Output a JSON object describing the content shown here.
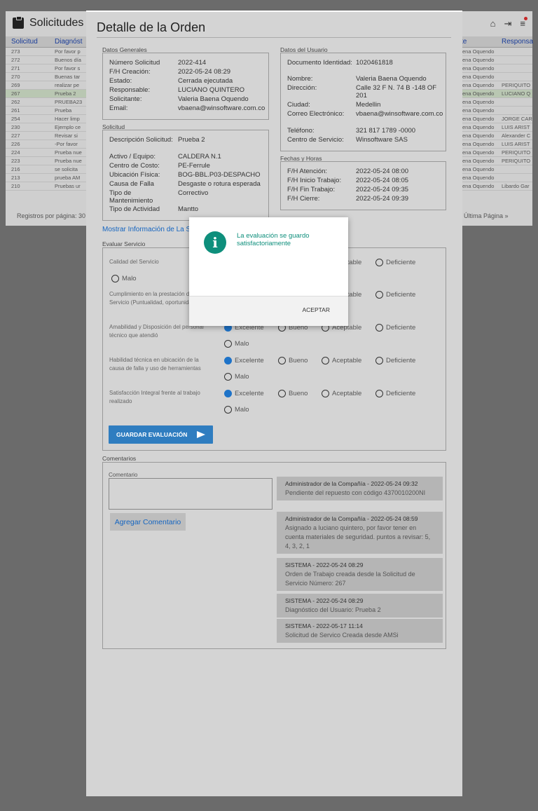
{
  "background": {
    "title": "Solicitudes",
    "columns": [
      "Solicitud",
      "Diagnóst",
      "te",
      "Responsa"
    ],
    "rows": [
      {
        "id": "273",
        "diag": "Por favor p",
        "resp": "ena Oquendo",
        "owner": ""
      },
      {
        "id": "272",
        "diag": "Buenos día",
        "resp": "ena Oquendo",
        "owner": ""
      },
      {
        "id": "271",
        "diag": "Por favor s",
        "resp": "ena Oquendo",
        "owner": ""
      },
      {
        "id": "270",
        "diag": "Buenas tar",
        "resp": "ena Oquendo",
        "owner": ""
      },
      {
        "id": "269",
        "diag": "realizar pe",
        "resp": "ena Oquendo",
        "owner": "PERIQUITO"
      },
      {
        "id": "267",
        "diag": "Prueba 2",
        "resp": "ena Oquendo",
        "owner": "LUCIANO Q"
      },
      {
        "id": "262",
        "diag": "PRUEBA23",
        "resp": "ena Oquendo",
        "owner": ""
      },
      {
        "id": "261",
        "diag": "Prueba",
        "resp": "ena Oquendo",
        "owner": ""
      },
      {
        "id": "254",
        "diag": "Hacer limp",
        "resp": "ena Oquendo",
        "owner": "JORGE CAR"
      },
      {
        "id": "230",
        "diag": "Ejemplo ce",
        "resp": "ena Oquendo",
        "owner": "LUIS ARIST"
      },
      {
        "id": "227",
        "diag": "Revisar si",
        "resp": "ena Oquendo",
        "owner": "Alexander C"
      },
      {
        "id": "226",
        "diag": "-Por favor",
        "resp": "ena Oquendo",
        "owner": "LUIS ARIST"
      },
      {
        "id": "224",
        "diag": "Prueba nue",
        "resp": "ena Oquendo",
        "owner": "PERIQUITO"
      },
      {
        "id": "223",
        "diag": "Prueba nue",
        "resp": "ena Oquendo",
        "owner": "PERIQUITO"
      },
      {
        "id": "216",
        "diag": "se solicita",
        "resp": "ena Oquendo",
        "owner": ""
      },
      {
        "id": "213",
        "diag": "prueba AM",
        "resp": "ena Oquendo",
        "owner": ""
      },
      {
        "id": "210",
        "diag": "Pruebas ur",
        "resp": "ena Oquendo",
        "owner": "Libardo Gar"
      }
    ],
    "footer": {
      "rows_per_page": "Registros por página: 30",
      "last_page": "Última Página »"
    }
  },
  "panel": {
    "title": "Detalle de la Orden",
    "general": {
      "label": "Datos Generales",
      "fields": [
        {
          "k": "Número Solicitud",
          "v": "2022-414"
        },
        {
          "k": "F/H Creación:",
          "v": "2022-05-24 08:29"
        },
        {
          "k": "Estado:",
          "v": "Cerrada ejecutada"
        },
        {
          "k": "Responsable:",
          "v": "LUCIANO QUINTERO"
        },
        {
          "k": "Solicitante:",
          "v": "Valeria Baena Oquendo"
        },
        {
          "k": "Email:",
          "v": "vbaena@winsoftware.com.co"
        }
      ]
    },
    "user": {
      "label": "Datos del Usuario",
      "fields": [
        {
          "k": "Documento Identidad:",
          "v": "1020461818"
        },
        {
          "k": "Nombre:",
          "v": "Valeria Baena Oquendo"
        },
        {
          "k": "Dirección:",
          "v": "Calle 32 F N. 74 B -148 OF 201"
        },
        {
          "k": "Ciudad:",
          "v": "Medellin"
        },
        {
          "k": "Correo Electrónico:",
          "v": "vbaena@winsoftware.com.co"
        },
        {
          "k": "Teléfono:",
          "v": "321 817 1789 -0000"
        },
        {
          "k": "Centro de Servicio:",
          "v": "Winsoftware SAS"
        }
      ]
    },
    "request": {
      "label": "Solicitud",
      "fields": [
        {
          "k": "Descripción Solicitud:",
          "v": "Prueba 2"
        },
        {
          "k": "Activo / Equipo:",
          "v": "CALDERA N.1"
        },
        {
          "k": "Centro de Costo:",
          "v": "PE-Ferrule"
        },
        {
          "k": "Ubicación Física:",
          "v": "BOG-BBL.P03-DESPACHO"
        },
        {
          "k": "Causa de Falla",
          "v": "Desgaste o rotura esperada"
        },
        {
          "k": "Tipo de Mantenimiento",
          "v": "Correctivo"
        },
        {
          "k": "Tipo de Actividad",
          "v": "Mantto"
        }
      ]
    },
    "dates": {
      "label": "Fechas y Horas",
      "fields": [
        {
          "k": "F/H Atención:",
          "v": "2022-05-24 08:00"
        },
        {
          "k": "F/H Inicio Trabajo:",
          "v": "2022-05-24 08:05"
        },
        {
          "k": "F/H Fin Trabajo:",
          "v": "2022-05-24 09:35"
        },
        {
          "k": "F/H Cierre:",
          "v": "2022-05-24 09:39"
        }
      ]
    },
    "show_more_link": "Mostrar Información de La S",
    "evaluation": {
      "label": "Evaluar Servicio",
      "options": [
        "Excelente",
        "Bueno",
        "Aceptable",
        "Deficiente",
        "Malo"
      ],
      "questions": [
        {
          "text": "Calidad del Servicio",
          "selected": null
        },
        {
          "text": "Cumplimiento en la prestación del Servicio (Puntualidad, oportunidad)",
          "selected": null
        },
        {
          "text": "Amabilidad y Disposición del personal técnico que atendió",
          "selected": "Excelente"
        },
        {
          "text": "Habilidad técnica en ubicación de la causa de falla y uso de herramientas",
          "selected": "Excelente"
        },
        {
          "text": "Satisfacción Integral frente al trabajo realizado",
          "selected": "Excelente"
        }
      ],
      "save_label": "GUARDAR EVALUACIÓN"
    },
    "comments": {
      "label": "Comentarios",
      "input_label": "Comentario",
      "add_label": "Agregar Comentario",
      "items": [
        {
          "head": "Administrador de la Compañía - 2022-05-24 09:32",
          "body": "Pendiente del repuesto con código 4370010200NI"
        },
        {
          "head": "Administrador de la Compañía - 2022-05-24 08:59",
          "body": "Asignado a luciano quintero, por favor tener en cuenta materiales de seguridad. puntos a revisar: 5, 4, 3, 2, 1"
        },
        {
          "head": "SISTEMA - 2022-05-24 08:29",
          "body": "Orden de Trabajo creada desde la Solicitud de Servicio Número: 267"
        },
        {
          "head": "SISTEMA - 2022-05-24 08:29",
          "body": "Diagnóstico del Usuario: Prueba 2"
        },
        {
          "head": "SISTEMA - 2022-05-17 11:14",
          "body": "Solicitud de Servico Creada desde AMSi"
        }
      ]
    }
  },
  "modal": {
    "message": "La evaluación se guardo satisfactoriamente",
    "accept_label": "ACEPTAR"
  }
}
